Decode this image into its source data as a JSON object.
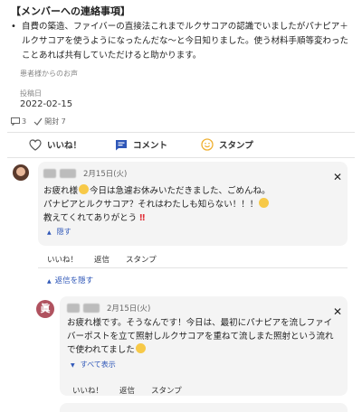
{
  "post": {
    "title": "【メンバーへの連絡事項】",
    "bullet": "•",
    "body": "自費の築造、ファイバーの直接法これまでルクサコアの認識でいましたがパナピア＋ルクサコアを使うようになったんだな〜と今日知りました。使う材料手順等変わったことあれば共有していただけると助かります。",
    "source_label": "患者様からのお声",
    "posted_label": "投稿日",
    "posted_date": "2022-02-15",
    "comment_count": "3",
    "read_count": "開封 7"
  },
  "actions": {
    "like": "いいね！",
    "comment": "コメント",
    "stamp": "スタンプ"
  },
  "comments": [
    {
      "date": "2月15日(火)",
      "line1_a": "お疲れ様",
      "line1_b": "今日は急遽お休みいただきました、ごめんね。",
      "line2": "パナピアとルクサコア？それはわたしも知らない！！！",
      "line3": "教えてくれてありがとう",
      "bang": "‼",
      "toggle": "隠す",
      "like": "いいね！",
      "reply": "返信",
      "stamp": "スタンプ"
    },
    {
      "avatar_text": "眞",
      "date": "2月15日(火)",
      "line1": "お疲れ様です。そうなんです！今日は、最初にパナピアを流しファイ",
      "line2": "バーポストを立て照射しルクサコアを重ねて流しまた照射という流れ",
      "line3": "で使われてました",
      "toggle": "すべて表示",
      "like": "いいね！",
      "reply": "返信",
      "stamp": "スタンプ"
    }
  ],
  "hide_replies": "返信を隠す",
  "colors": {
    "link": "#2f57b8",
    "comment_icon": "#2f57b8",
    "stamp_icon": "#f0b030",
    "card_bg": "#f4f4f4"
  }
}
